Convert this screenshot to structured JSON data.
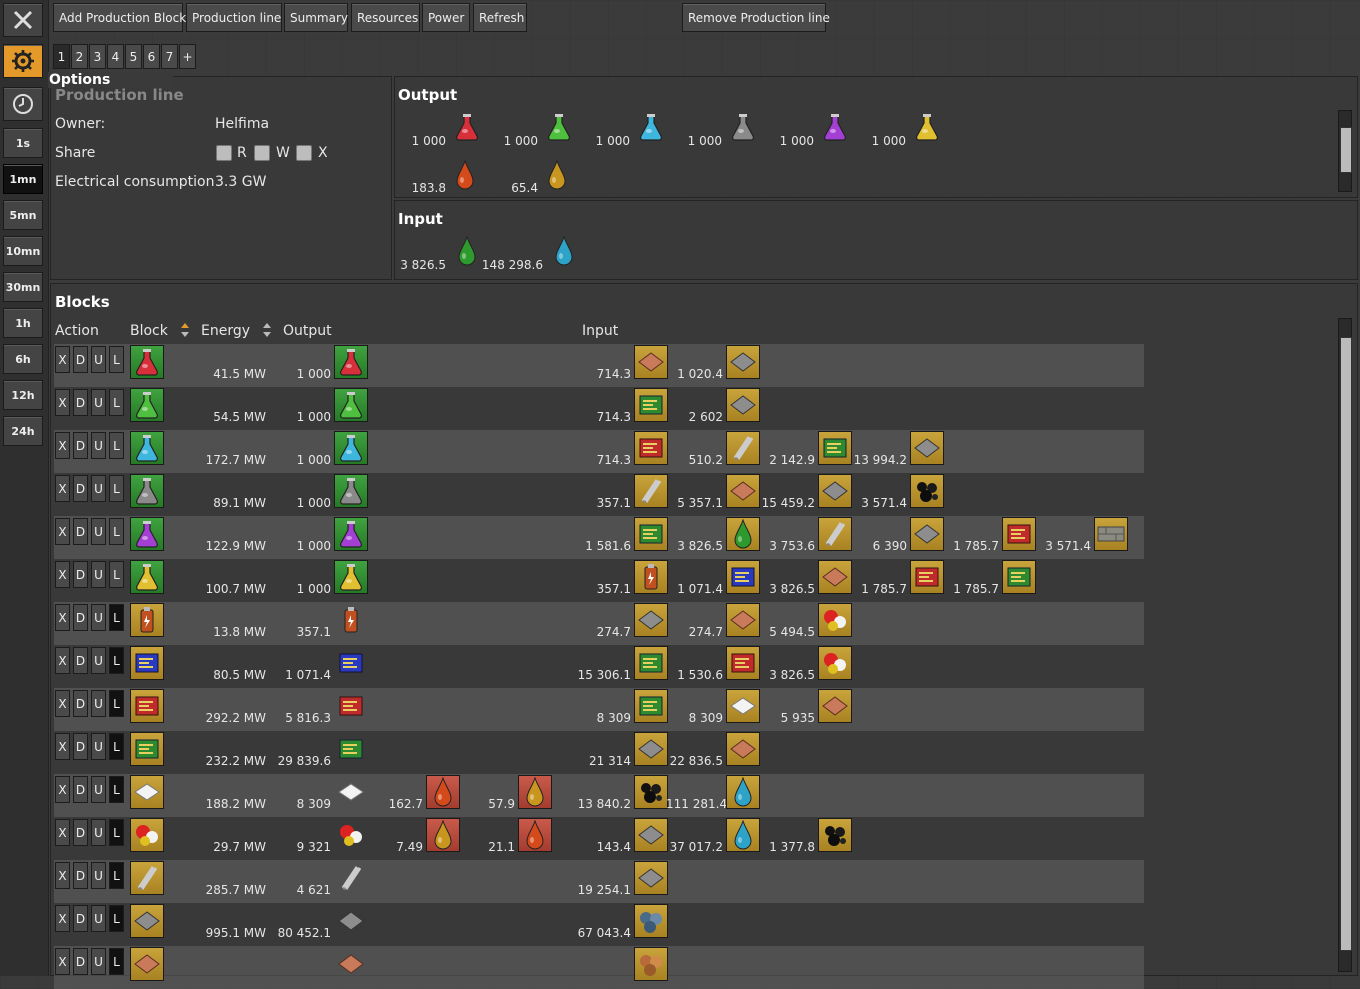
{
  "toolbar": {
    "add_block": "Add Production Block",
    "production_line": "Production line",
    "summary": "Summary",
    "resources": "Resources",
    "power": "Power",
    "refresh": "Refresh",
    "remove_line": "Remove Production line"
  },
  "tabs": [
    "1",
    "2",
    "3",
    "4",
    "5",
    "6",
    "7",
    "+"
  ],
  "side": {
    "options_tooltip": "Options",
    "times": [
      "1s",
      "1mn",
      "5mn",
      "10mn",
      "30mn",
      "1h",
      "6h",
      "12h",
      "24h"
    ],
    "selected_time": "1mn"
  },
  "info": {
    "title": "Production line",
    "owner_label": "Owner:",
    "owner_value": "Helfima",
    "share_label": "Share",
    "share_r": "R",
    "share_w": "W",
    "share_x": "X",
    "elec_label": "Electrical consumption",
    "elec_value": "3.3 GW"
  },
  "output": {
    "title": "Output",
    "items": [
      {
        "value": "1 000",
        "icon": "automation-science-pack-icon",
        "color": "#d7303b"
      },
      {
        "value": "1 000",
        "icon": "logistic-science-pack-icon",
        "color": "#4fbf3f"
      },
      {
        "value": "1 000",
        "icon": "chemical-science-pack-icon",
        "color": "#3fb6dd"
      },
      {
        "value": "1 000",
        "icon": "military-science-pack-icon",
        "color": "#8a8a8a"
      },
      {
        "value": "1 000",
        "icon": "production-science-pack-icon",
        "color": "#a43fd4"
      },
      {
        "value": "1 000",
        "icon": "utility-science-pack-icon",
        "color": "#e0c030"
      },
      {
        "value": "183.8",
        "icon": "heavy-oil-icon",
        "color": "#d44a1a"
      },
      {
        "value": "65.4",
        "icon": "light-oil-icon",
        "color": "#c8961e"
      }
    ]
  },
  "input": {
    "title": "Input",
    "items": [
      {
        "value": "3 826.5",
        "icon": "petroleum-gas-icon",
        "color": "#2e9a2e"
      },
      {
        "value": "148 298.6",
        "icon": "water-icon",
        "color": "#2ea3c8"
      }
    ]
  },
  "blocks": {
    "title": "Blocks",
    "headers": {
      "action": "Action",
      "block": "Block",
      "energy": "Energy",
      "output": "Output",
      "input": "Input"
    },
    "action_labels": [
      "X",
      "D",
      "U",
      "L"
    ],
    "rows": [
      {
        "block": "red-pack",
        "energy": "41.5 MW",
        "outputs": [
          {
            "v": "1 000",
            "i": "red-pack"
          }
        ],
        "inputs": [
          {
            "v": "714.3",
            "i": "copper-plate"
          },
          {
            "v": "1 020.4",
            "i": "iron-plate"
          }
        ]
      },
      {
        "block": "green-pack",
        "energy": "54.5 MW",
        "outputs": [
          {
            "v": "1 000",
            "i": "green-pack"
          }
        ],
        "inputs": [
          {
            "v": "714.3",
            "i": "green-circuit"
          },
          {
            "v": "2 602",
            "i": "iron-plate"
          }
        ]
      },
      {
        "block": "blue-pack",
        "energy": "172.7 MW",
        "outputs": [
          {
            "v": "1 000",
            "i": "blue-pack"
          }
        ],
        "inputs": [
          {
            "v": "714.3",
            "i": "red-circuit"
          },
          {
            "v": "510.2",
            "i": "steel"
          },
          {
            "v": "2 142.9",
            "i": "green-circuit"
          },
          {
            "v": "13 994.2",
            "i": "iron-plate"
          }
        ]
      },
      {
        "block": "grey-pack",
        "energy": "89.1 MW",
        "outputs": [
          {
            "v": "1 000",
            "i": "grey-pack"
          }
        ],
        "inputs": [
          {
            "v": "357.1",
            "i": "steel"
          },
          {
            "v": "5 357.1",
            "i": "copper-plate"
          },
          {
            "v": "15 459.2",
            "i": "iron-plate"
          },
          {
            "v": "3 571.4",
            "i": "coal"
          }
        ]
      },
      {
        "block": "purple-pack",
        "energy": "122.9 MW",
        "outputs": [
          {
            "v": "1 000",
            "i": "purple-pack"
          }
        ],
        "inputs": [
          {
            "v": "1 581.6",
            "i": "green-circuit"
          },
          {
            "v": "3 826.5",
            "i": "petroleum"
          },
          {
            "v": "3 753.6",
            "i": "steel"
          },
          {
            "v": "6 390",
            "i": "iron-plate"
          },
          {
            "v": "1 785.7",
            "i": "red-circuit"
          },
          {
            "v": "3 571.4",
            "i": "stone-brick"
          }
        ]
      },
      {
        "block": "yellow-pack",
        "energy": "100.7 MW",
        "outputs": [
          {
            "v": "1 000",
            "i": "yellow-pack"
          }
        ],
        "inputs": [
          {
            "v": "357.1",
            "i": "battery"
          },
          {
            "v": "1 071.4",
            "i": "blue-circuit"
          },
          {
            "v": "3 826.5",
            "i": "copper-plate"
          },
          {
            "v": "1 785.7",
            "i": "red-circuit"
          },
          {
            "v": "1 785.7",
            "i": "green-circuit"
          }
        ]
      },
      {
        "block": "battery",
        "energy": "13.8 MW",
        "outputs": [
          {
            "v": "357.1",
            "i": "battery"
          }
        ],
        "inputs": [
          {
            "v": "274.7",
            "i": "iron-plate"
          },
          {
            "v": "274.7",
            "i": "copper-plate"
          },
          {
            "v": "5 494.5",
            "i": "sulfur"
          }
        ]
      },
      {
        "block": "blue-circuit",
        "energy": "80.5 MW",
        "outputs": [
          {
            "v": "1 071.4",
            "i": "blue-circuit"
          }
        ],
        "inputs": [
          {
            "v": "15 306.1",
            "i": "green-circuit"
          },
          {
            "v": "1 530.6",
            "i": "red-circuit"
          },
          {
            "v": "3 826.5",
            "i": "sulfur"
          }
        ]
      },
      {
        "block": "red-circuit",
        "energy": "292.2 MW",
        "outputs": [
          {
            "v": "5 816.3",
            "i": "red-circuit"
          }
        ],
        "inputs": [
          {
            "v": "8 309",
            "i": "green-circuit"
          },
          {
            "v": "8 309",
            "i": "plastic"
          },
          {
            "v": "5 935",
            "i": "copper-plate"
          }
        ]
      },
      {
        "block": "green-circuit",
        "energy": "232.2 MW",
        "outputs": [
          {
            "v": "29 839.6",
            "i": "green-circuit"
          }
        ],
        "inputs": [
          {
            "v": "21 314",
            "i": "iron-plate"
          },
          {
            "v": "22 836.5",
            "i": "copper-plate"
          }
        ]
      },
      {
        "block": "plastic",
        "energy": "188.2 MW",
        "outputs": [
          {
            "v": "8 309",
            "i": "plastic"
          },
          {
            "v": "162.7",
            "i": "heavy-oil-red"
          },
          {
            "v": "57.9",
            "i": "light-oil-red"
          }
        ],
        "inputs": [
          {
            "v": "13 840.2",
            "i": "coal"
          },
          {
            "v": "111 281.4",
            "i": "water"
          }
        ]
      },
      {
        "block": "sulfur",
        "energy": "29.7 MW",
        "outputs": [
          {
            "v": "9 321",
            "i": "sulfur"
          },
          {
            "v": "7.49",
            "i": "light-oil-red"
          },
          {
            "v": "21.1",
            "i": "heavy-oil-red"
          }
        ],
        "inputs": [
          {
            "v": "143.4",
            "i": "iron-plate"
          },
          {
            "v": "37 017.2",
            "i": "water"
          },
          {
            "v": "1 377.8",
            "i": "coal"
          }
        ]
      },
      {
        "block": "steel",
        "energy": "285.7 MW",
        "outputs": [
          {
            "v": "4 621",
            "i": "steel"
          }
        ],
        "inputs": [
          {
            "v": "19 254.1",
            "i": "iron-plate"
          }
        ]
      },
      {
        "block": "iron-plate",
        "energy": "995.1 MW",
        "outputs": [
          {
            "v": "80 452.1",
            "i": "iron-plate"
          }
        ],
        "inputs": [
          {
            "v": "67 043.4",
            "i": "iron-ore"
          }
        ]
      },
      {
        "block": "copper-plate",
        "energy": "",
        "outputs": [
          {
            "v": "",
            "i": "copper-plate"
          }
        ],
        "inputs": [
          {
            "v": "",
            "i": "copper-ore"
          }
        ]
      }
    ]
  }
}
